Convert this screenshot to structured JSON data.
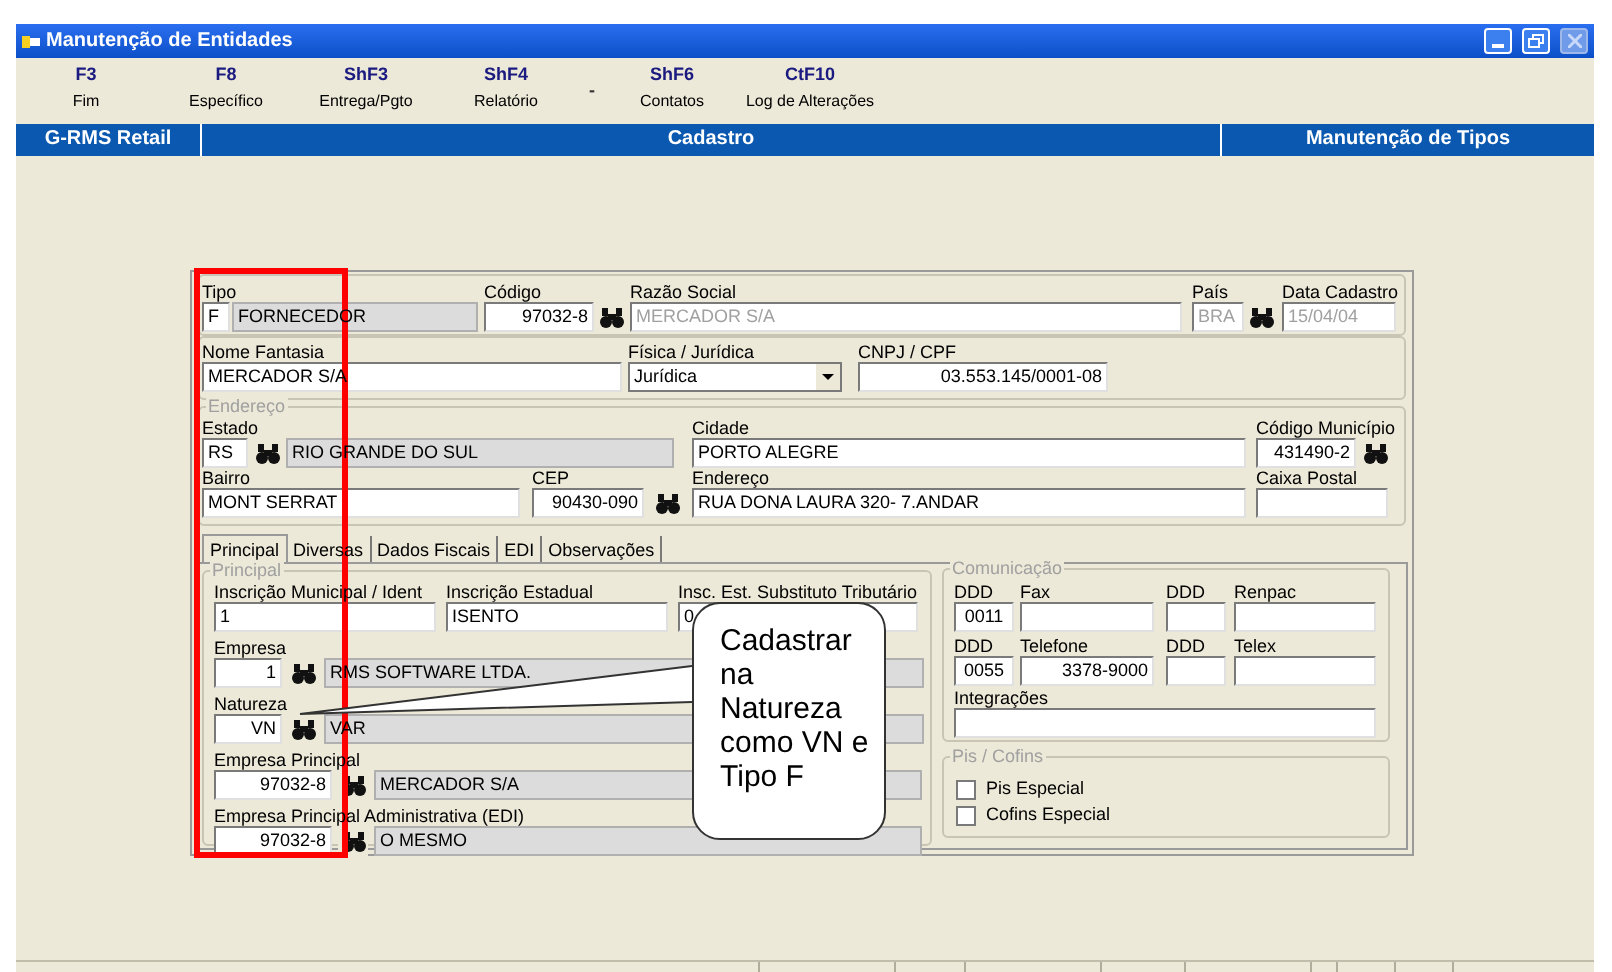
{
  "window": {
    "title": "Manutenção de Entidades"
  },
  "toolbar": [
    {
      "kind": "command",
      "key": "F3",
      "label": "Fim"
    },
    {
      "kind": "command",
      "key": "F8",
      "label": "Específico"
    },
    {
      "kind": "command",
      "key": "ShF3",
      "label": "Entrega/Pgto"
    },
    {
      "kind": "command",
      "key": "ShF4",
      "label": "Relatório"
    },
    {
      "kind": "mark",
      "key": "-"
    },
    {
      "kind": "command",
      "key": "ShF6",
      "label": "Contatos"
    },
    {
      "kind": "command",
      "key": "CtF10",
      "label": "Log de Alterações"
    }
  ],
  "header_bar": [
    "G-RMS Retail",
    "Cadastro",
    "Manutenção de Tipos"
  ],
  "identificacao": {
    "tipo": {
      "label": "Tipo",
      "code": "F",
      "description": "FORNECEDOR"
    },
    "codigo": {
      "label": "Código",
      "value": "97032-8"
    },
    "razao_social": {
      "label": "Razão Social",
      "value": "MERCADOR S/A",
      "disabled": true
    },
    "pais": {
      "label": "País",
      "value": "BRA",
      "disabled": true
    },
    "data_cadastro": {
      "label": "Data Cadastro",
      "value": "15/04/04",
      "disabled": true
    }
  },
  "dados": {
    "nome_fantasia": {
      "label": "Nome Fantasia",
      "value": "MERCADOR S/A"
    },
    "fisica_juridica": {
      "label": "Física / Jurídica",
      "value": "Jurídica"
    },
    "cnpj_cpf": {
      "label": "CNPJ / CPF",
      "value": "03.553.145/0001-08"
    }
  },
  "endereco": {
    "title": "Endereço",
    "estado": {
      "label": "Estado",
      "code": "RS",
      "description": "RIO GRANDE DO SUL"
    },
    "cidade": {
      "label": "Cidade",
      "value": "PORTO ALEGRE"
    },
    "codigo_municipio": {
      "label": "Código Município",
      "value": "431490-2"
    },
    "bairro": {
      "label": "Bairro",
      "value": "MONT SERRAT"
    },
    "cep": {
      "label": "CEP",
      "value": "90430-090"
    },
    "endereco": {
      "label": "Endereço",
      "value": "RUA DONA LAURA 320- 7.ANDAR"
    },
    "caixa_postal": {
      "label": "Caixa Postal"
    }
  },
  "tabs": [
    {
      "label": "Principal",
      "selected": true
    },
    {
      "label": "Diversas",
      "selected": false
    },
    {
      "label": "Dados Fiscais",
      "selected": false
    },
    {
      "label": "EDI",
      "selected": false
    },
    {
      "label": "Observações",
      "selected": false
    }
  ],
  "principal": {
    "title": "Principal",
    "inscricoes": [
      {
        "label": "Inscrição Municipal / Ident",
        "value": "1"
      },
      {
        "label": "Inscrição Estadual",
        "value": "ISENTO"
      },
      {
        "label": "Insc. Est. Substituto Tributário",
        "value": "0"
      }
    ],
    "lookups": [
      {
        "label": "Empresa",
        "code": "1",
        "description": "RMS SOFTWARE LTDA."
      },
      {
        "label": "Natureza",
        "code": "VN",
        "description": "VAR"
      },
      {
        "label": "Empresa Principal",
        "code": "97032-8",
        "description": "MERCADOR S/A"
      },
      {
        "label": "Empresa Principal Administrativa (EDI)",
        "code": "97032-8",
        "description": "O MESMO"
      }
    ]
  },
  "comunicacao": {
    "title": "Comunicação",
    "fields": [
      {
        "label": "DDD",
        "value": "0011"
      },
      {
        "label": "Fax"
      },
      {
        "label": "DDD"
      },
      {
        "label": "Renpac"
      },
      {
        "label": "DDD",
        "value": "0055"
      },
      {
        "label": "Telefone",
        "value": "3378-9000"
      },
      {
        "label": "DDD"
      },
      {
        "label": "Telex"
      }
    ],
    "integracoes": {
      "label": "Integrações"
    }
  },
  "pis_cofins": {
    "title": "Pis / Cofins",
    "options": [
      {
        "label": "Pis Especial",
        "checked": false
      },
      {
        "label": "Cofins Especial",
        "checked": false
      }
    ]
  },
  "callout": {
    "text": "Cadastrar na Natureza como VN e Tipo F"
  }
}
